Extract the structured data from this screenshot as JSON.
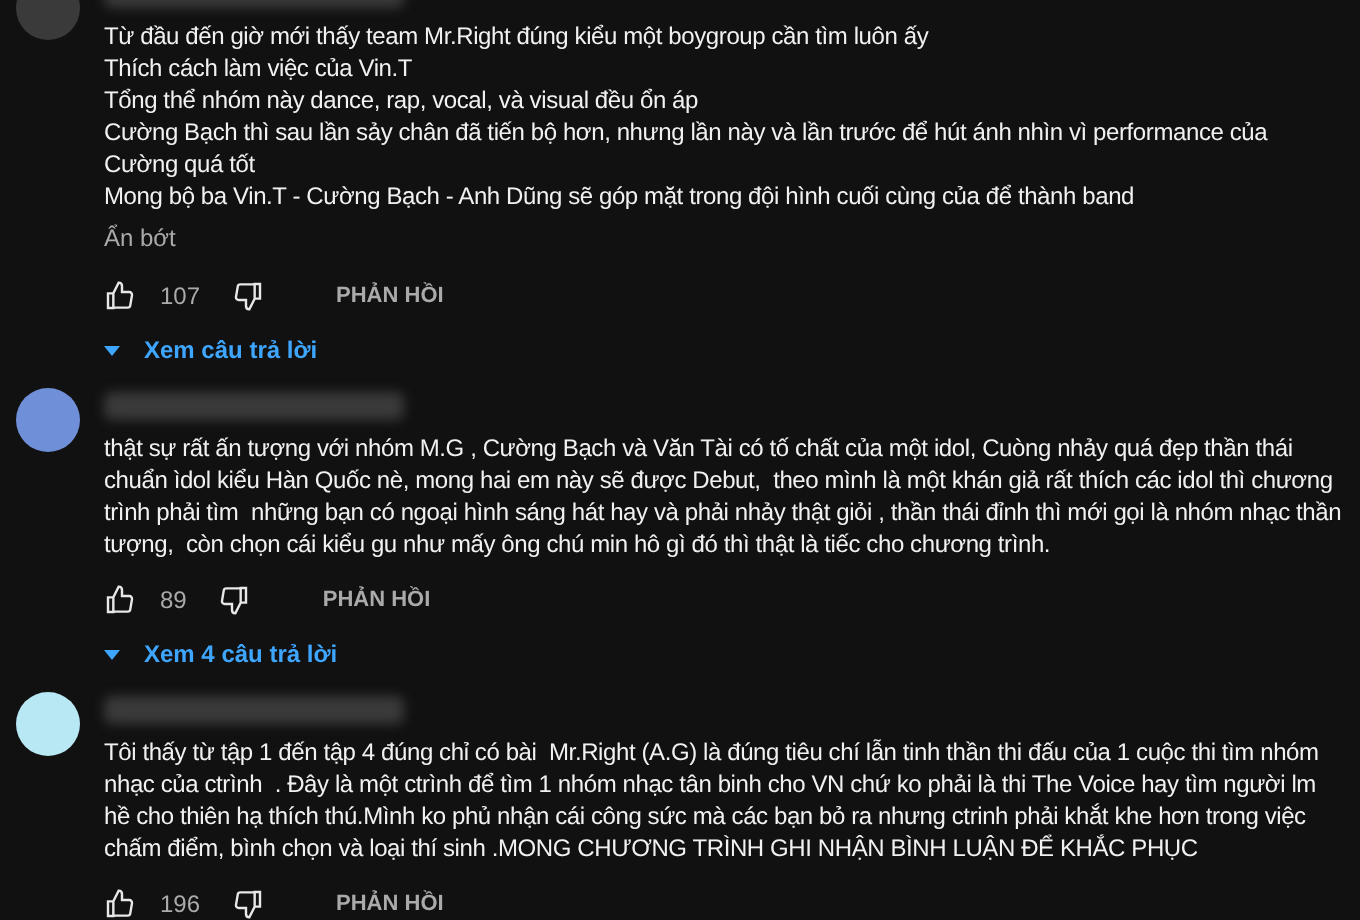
{
  "comments": [
    {
      "color": "#3a3a3a",
      "text": "Từ đầu đến giờ mới thấy team Mr.Right đúng kiểu một boygroup cần tìm luôn ấy\nThích cách làm việc của Vin.T\nTổng thể nhóm này dance, rap, vocal, và visual đều ổn áp\nCường Bạch thì sau lần sảy chân đã tiến bộ hơn, nhưng lần này và lần trước để hút ánh nhìn vì performance của Cường quá tốt\nMong bộ ba Vin.T - Cường Bạch - Anh Dũng sẽ góp mặt trong đội hình cuối cùng của để thành band",
      "show_less": "Ẩn bớt",
      "likes": "107",
      "reply": "PHẢN HỒI",
      "view_replies": "Xem câu trả lời"
    },
    {
      "color": "#6f8fd8",
      "text": "thật sự rất ấn tượng với nhóm M.G , Cường Bạch và Văn Tài có tố chất của một idol, Cuòng nhảy quá đẹp thần thái chuẩn ìdol kiểu Hàn Quốc nè, mong hai em này sẽ được Debut,  theo mình là một khán giả rất thích các idol thì chương trình phải tìm  những bạn có ngoại hình sáng hát hay và phải nhảy thật giỏi , thần thái đỉnh thì mới gọi là nhóm nhạc thần tượng,  còn chọn cái kiểu gu như mấy ông chú min hô gì đó thì thật là tiếc cho chương trình.",
      "likes": "89",
      "reply": "PHẢN HỒI",
      "view_replies": "Xem 4 câu trả lời"
    },
    {
      "color": "#b9e8f5",
      "text": "Tôi thấy từ tập 1 đến tập 4 đúng chỉ có bài  Mr.Right (A.G) là đúng tiêu chí lẫn tinh thần thi đấu của 1 cuộc thi tìm nhóm nhạc của ctrình  . Đây là một ctrình để tìm 1 nhóm nhạc tân binh cho VN chứ ko phải là thi The Voice hay tìm người lm hề cho thiên hạ thích thú.Mình ko phủ nhận cái công sức mà các bạn bỏ ra nhưng ctrinh phải khắt khe hơn trong việc chấm điểm, bình chọn và loại thí sinh .MONG CHƯƠNG TRÌNH GHI NHẬN BÌNH LUẬN ĐỂ KHẮC PHỤC",
      "likes": "196",
      "reply": "PHẢN HỒI"
    }
  ]
}
